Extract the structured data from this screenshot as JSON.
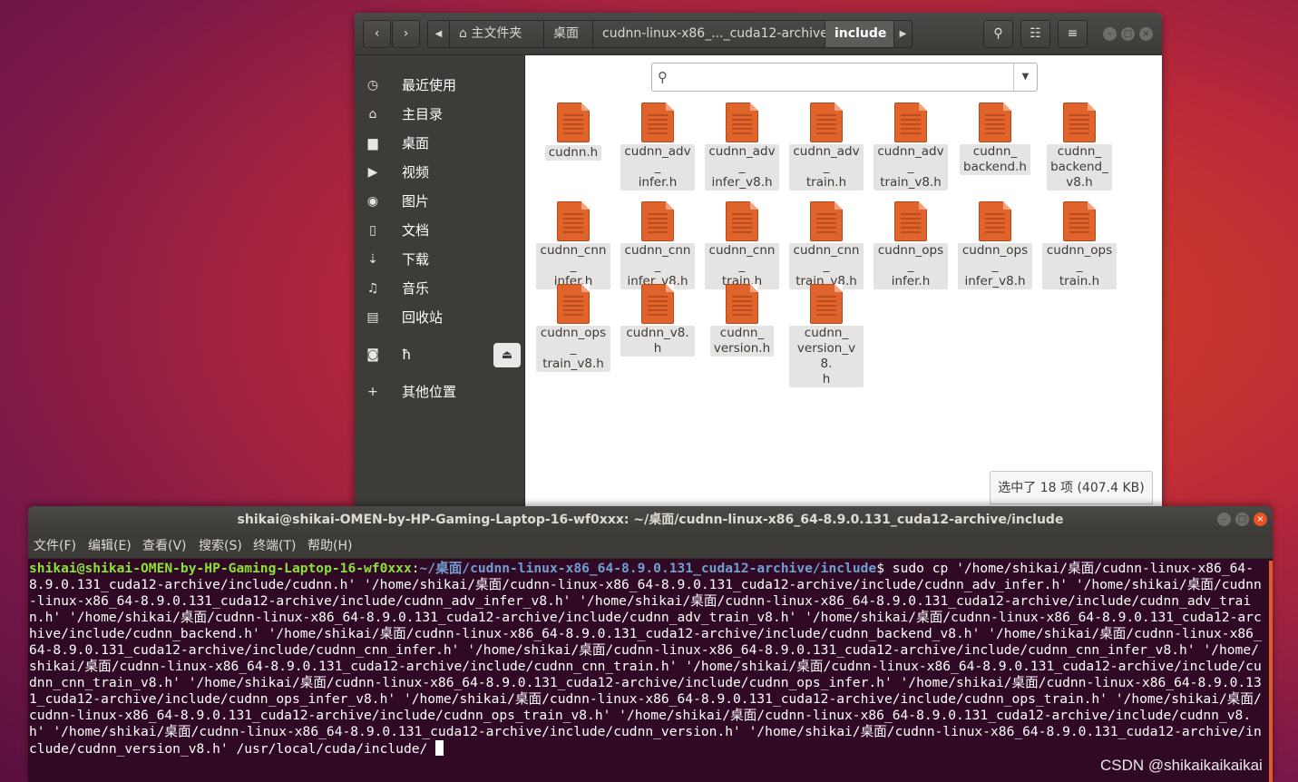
{
  "file_manager": {
    "breadcrumbs": [
      "主文件夹",
      "桌面",
      "cudnn-linux-x86_..._cuda12-archive",
      "include"
    ],
    "sidebar": [
      {
        "icon": "clock-icon",
        "glyph": "◷",
        "label": "最近使用"
      },
      {
        "icon": "home-icon",
        "glyph": "⌂",
        "label": "主目录"
      },
      {
        "icon": "folder-icon",
        "glyph": "▆",
        "label": "桌面"
      },
      {
        "icon": "video-icon",
        "glyph": "▶",
        "label": "视频"
      },
      {
        "icon": "camera-icon",
        "glyph": "◉",
        "label": "图片"
      },
      {
        "icon": "document-icon",
        "glyph": "▯",
        "label": "文档"
      },
      {
        "icon": "download-icon",
        "glyph": "⇣",
        "label": "下载"
      },
      {
        "icon": "music-icon",
        "glyph": "♫",
        "label": "音乐"
      },
      {
        "icon": "trash-icon",
        "glyph": "▤",
        "label": "回收站"
      },
      {
        "icon": "drive-icon",
        "glyph": "◙",
        "label": "ħ"
      },
      {
        "icon": "plus-icon",
        "glyph": "+",
        "label": "其他位置"
      }
    ],
    "files": [
      "cudnn.h",
      "cudnn_adv_infer.h",
      "cudnn_adv_infer_v8.h",
      "cudnn_adv_train.h",
      "cudnn_adv_train_v8.h",
      "cudnn_backend.h",
      "cudnn_backend_v8.h",
      "cudnn_cnn_infer.h",
      "cudnn_cnn_infer_v8.h",
      "cudnn_cnn_train.h",
      "cudnn_cnn_train_v8.h",
      "cudnn_ops_infer.h",
      "cudnn_ops_infer_v8.h",
      "cudnn_ops_train.h",
      "cudnn_ops_train_v8.h",
      "cudnn_v8.h",
      "cudnn_version.h",
      "cudnn_version_v8.h"
    ],
    "file_labels": [
      [
        "cudnn.h"
      ],
      [
        "cudnn_adv_",
        "infer.h"
      ],
      [
        "cudnn_adv_",
        "infer_v8.h"
      ],
      [
        "cudnn_adv_",
        "train.h"
      ],
      [
        "cudnn_adv_",
        "train_v8.h"
      ],
      [
        "cudnn_",
        "backend.h"
      ],
      [
        "cudnn_",
        "backend_",
        "v8.h"
      ],
      [
        "cudnn_cnn_",
        "infer.h"
      ],
      [
        "cudnn_cnn_",
        "infer_v8.h"
      ],
      [
        "cudnn_cnn_",
        "train.h"
      ],
      [
        "cudnn_cnn_",
        "train_v8.h"
      ],
      [
        "cudnn_ops_",
        "infer.h"
      ],
      [
        "cudnn_ops_",
        "infer_v8.h"
      ],
      [
        "cudnn_ops_",
        "train.h"
      ],
      [
        "cudnn_ops_",
        "train_v8.h"
      ],
      [
        "cudnn_v8.h"
      ],
      [
        "cudnn_",
        "version.h"
      ],
      [
        "cudnn_",
        "version_v8.",
        "h"
      ]
    ],
    "status": "选中了 18 项 (407.4 KB)"
  },
  "terminal": {
    "title": "shikai@shikai-OMEN-by-HP-Gaming-Laptop-16-wf0xxx: ~/桌面/cudnn-linux-x86_64-8.9.0.131_cuda12-archive/include",
    "menu": [
      "文件(F)",
      "编辑(E)",
      "查看(V)",
      "搜索(S)",
      "终端(T)",
      "帮助(H)"
    ],
    "prompt_user": "shikai@shikai-OMEN-by-HP-Gaming-Laptop-16-wf0xxx",
    "prompt_sep": ":",
    "prompt_path": "~/桌面/cudnn-linux-x86_64-8.9.0.131_cuda12-archive/include",
    "prompt_symbol": "$ ",
    "command": "sudo cp '/home/shikai/桌面/cudnn-linux-x86_64-8.9.0.131_cuda12-archive/include/cudnn.h' '/home/shikai/桌面/cudnn-linux-x86_64-8.9.0.131_cuda12-archive/include/cudnn_adv_infer.h' '/home/shikai/桌面/cudnn-linux-x86_64-8.9.0.131_cuda12-archive/include/cudnn_adv_infer_v8.h' '/home/shikai/桌面/cudnn-linux-x86_64-8.9.0.131_cuda12-archive/include/cudnn_adv_train.h' '/home/shikai/桌面/cudnn-linux-x86_64-8.9.0.131_cuda12-archive/include/cudnn_adv_train_v8.h' '/home/shikai/桌面/cudnn-linux-x86_64-8.9.0.131_cuda12-archive/include/cudnn_backend.h' '/home/shikai/桌面/cudnn-linux-x86_64-8.9.0.131_cuda12-archive/include/cudnn_backend_v8.h' '/home/shikai/桌面/cudnn-linux-x86_64-8.9.0.131_cuda12-archive/include/cudnn_cnn_infer.h' '/home/shikai/桌面/cudnn-linux-x86_64-8.9.0.131_cuda12-archive/include/cudnn_cnn_infer_v8.h' '/home/shikai/桌面/cudnn-linux-x86_64-8.9.0.131_cuda12-archive/include/cudnn_cnn_train.h' '/home/shikai/桌面/cudnn-linux-x86_64-8.9.0.131_cuda12-archive/include/cudnn_cnn_train_v8.h' '/home/shikai/桌面/cudnn-linux-x86_64-8.9.0.131_cuda12-archive/include/cudnn_ops_infer.h' '/home/shikai/桌面/cudnn-linux-x86_64-8.9.0.131_cuda12-archive/include/cudnn_ops_infer_v8.h' '/home/shikai/桌面/cudnn-linux-x86_64-8.9.0.131_cuda12-archive/include/cudnn_ops_train.h' '/home/shikai/桌面/cudnn-linux-x86_64-8.9.0.131_cuda12-archive/include/cudnn_ops_train_v8.h' '/home/shikai/桌面/cudnn-linux-x86_64-8.9.0.131_cuda12-archive/include/cudnn_v8.h' '/home/shikai/桌面/cudnn-linux-x86_64-8.9.0.131_cuda12-archive/include/cudnn_version.h' '/home/shikai/桌面/cudnn-linux-x86_64-8.9.0.131_cuda12-archive/include/cudnn_version_v8.h' /usr/local/cuda/include/ "
  },
  "watermark": "CSDN @shikaikaikaikai",
  "colors": {
    "terminal_bg": "#300a24",
    "prompt_user": "#8ae234",
    "prompt_path": "#729fcf",
    "file_icon": "#e0632b"
  }
}
